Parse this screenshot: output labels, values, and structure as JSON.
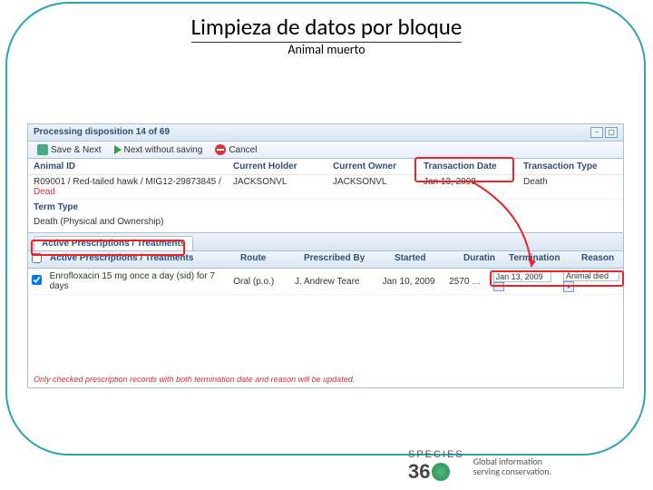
{
  "slide": {
    "title": "Limpieza de datos por bloque",
    "subtitle": "Animal muerto"
  },
  "window": {
    "title": "Processing disposition 14 of 69",
    "toolbar": {
      "save_next": "Save & Next",
      "next_wo_save": "Next without saving",
      "cancel": "Cancel"
    },
    "headers": {
      "animal_id": "Animal ID",
      "current_holder": "Current Holder",
      "current_owner": "Current Owner",
      "tx_date": "Transaction Date",
      "tx_type": "Transaction Type"
    },
    "record": {
      "animal_id": "R09001 / Red-tailed hawk / MIG12-29873845 /",
      "dead": " Dead",
      "holder": "JACKSONVL",
      "owner": "JACKSONVL",
      "tx_date": "Jan 13, 2009",
      "tx_type": "Death"
    },
    "term_type_label": "Term Type",
    "term_type_value": "Death (Physical and Ownership)",
    "tab_label": "Active Prescriptions / Treatments",
    "grid_headers": {
      "desc": "Active Prescriptions / Treatments",
      "route": "Route",
      "prescribed_by": "Prescribed By",
      "started": "Started",
      "duration": "Duratin",
      "termination": "Termination",
      "reason": "Reason"
    },
    "grid_row": {
      "desc": "Enrofloxacin 15 mg once a day (sid) for 7 days",
      "route": "Oral (p.o.)",
      "prescribed_by": "J. Andrew Teare",
      "started": "Jan 10, 2009",
      "duration": "2570 …",
      "termination": "Jan 13, 2009",
      "reason": "Animal died"
    },
    "note": "Only checked prescription records with both termination date and reason will be updated."
  },
  "footer": {
    "brand_top": "SPECIES",
    "brand_3": "3",
    "brand_6": "6",
    "brand_0": "0",
    "tag1": "Global information",
    "tag2": "serving conservation."
  }
}
